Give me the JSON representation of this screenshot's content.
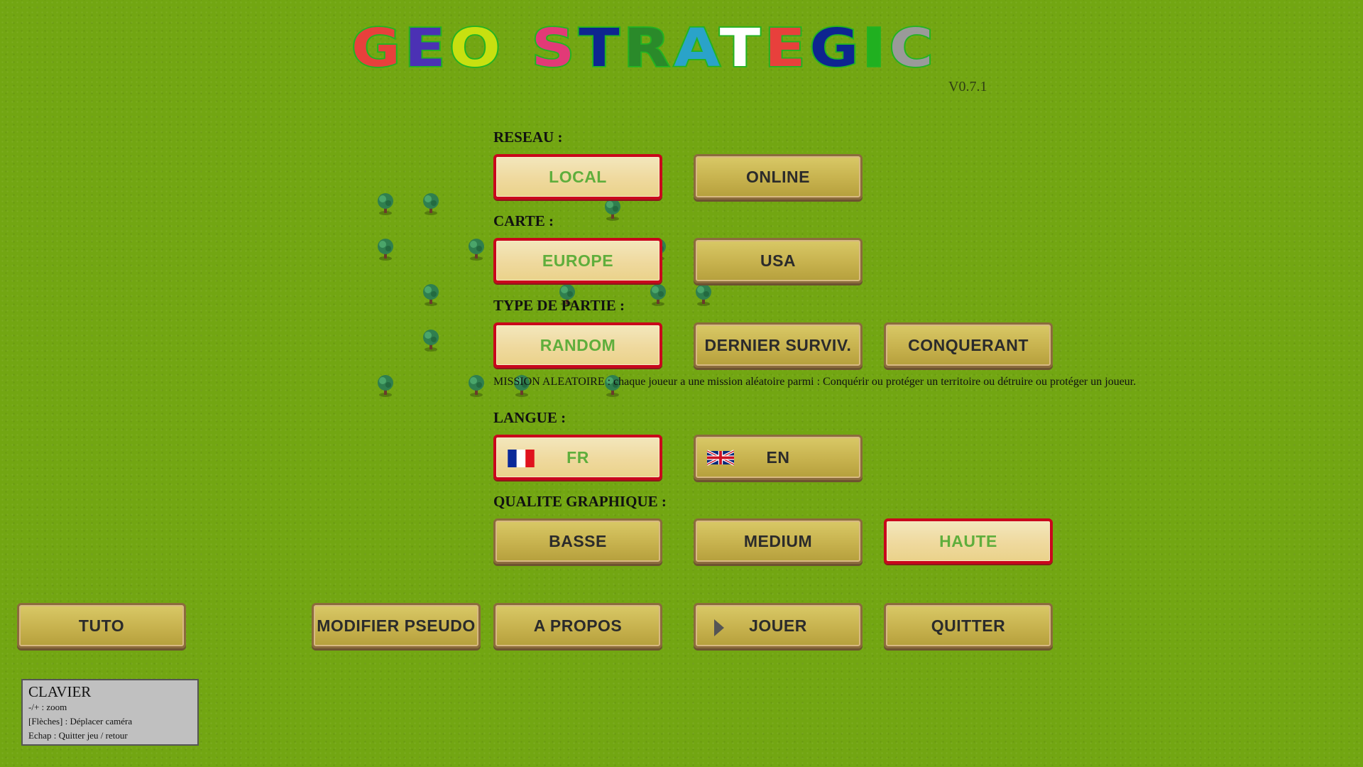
{
  "title": {
    "word1": [
      "G",
      "E",
      "O"
    ],
    "word2": [
      "S",
      "T",
      "R",
      "A",
      "T",
      "E",
      "G",
      "I",
      "C"
    ],
    "colors1": [
      "#e8403c",
      "#4b31b4",
      "#c8e010"
    ],
    "colors2": [
      "#e23a77",
      "#0e2590",
      "#2a8a2a",
      "#2aa3c9",
      "#ffffff",
      "#e8403c",
      "#0e2590",
      "#20b020",
      "#9a9a9a"
    ],
    "version": "V0.7.1"
  },
  "sections": {
    "reseau": "RESEAU :",
    "carte": "CARTE :",
    "type": "TYPE DE PARTIE :",
    "langue": "LANGUE :",
    "qualite": "QUALITE GRAPHIQUE :"
  },
  "buttons": {
    "local": "LOCAL",
    "online": "ONLINE",
    "europe": "EUROPE",
    "usa": "USA",
    "random": "RANDOM",
    "dernier": "DERNIER SURVIV.",
    "conquerant": "CONQUERANT",
    "fr": "FR",
    "en": "EN",
    "basse": "BASSE",
    "medium": "MEDIUM",
    "haute": "HAUTE",
    "tuto": "TUTO",
    "pseudo": "MODIFIER PSEUDO",
    "apropos": "A PROPOS",
    "jouer": "JOUER",
    "quitter": "QUITTER"
  },
  "mission_description": "MISSION ALEATOIRE : chaque joueur a une mission aléatoire parmi : Conquérir ou protéger un territoire ou détruire ou protéger un joueur.",
  "keyboard": {
    "title": "CLAVIER",
    "lines": [
      "-/+ : zoom",
      "[Flèches] : Déplacer caméra",
      "Echap : Quitter jeu / retour"
    ]
  },
  "colors": {
    "background": "#72a612",
    "selected_border": "#c9061c",
    "selected_text": "#5fae3c"
  },
  "icons": [
    "tree-icon",
    "flag-fr-icon",
    "flag-uk-icon",
    "play-icon"
  ]
}
